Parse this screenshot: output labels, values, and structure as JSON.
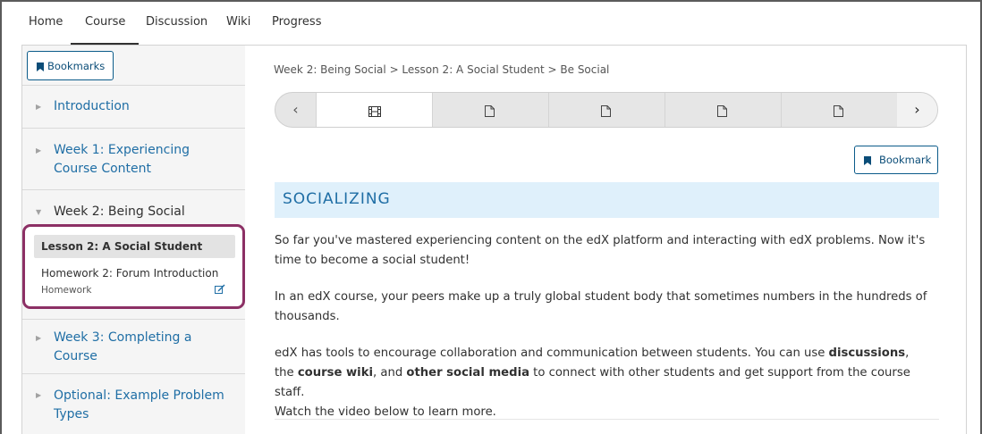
{
  "topnav": {
    "tabs": [
      {
        "label": "Home"
      },
      {
        "label": "Course"
      },
      {
        "label": "Discussion"
      },
      {
        "label": "Wiki"
      },
      {
        "label": "Progress"
      }
    ],
    "active_tab": "Course"
  },
  "sidebar": {
    "bookmarks_label": "Bookmarks",
    "sections": [
      {
        "title": "Introduction"
      },
      {
        "title": "Week 1: Experiencing Course Content"
      },
      {
        "title": "Week 2: Being Social"
      },
      {
        "title": "Week 3: Completing a Course"
      },
      {
        "title": "Optional: Example Problem Types"
      }
    ],
    "open_section": {
      "active_subsection": "Lesson 2: A Social Student",
      "subsection_title": "Homework 2: Forum Introduction",
      "subsection_type": "Homework"
    }
  },
  "main": {
    "breadcrumb": "Week 2: Being Social > Lesson 2: A Social Student > Be Social",
    "sequence": {
      "tabs": [
        {
          "icon": "video-icon",
          "active": true
        },
        {
          "icon": "page-icon",
          "active": false
        },
        {
          "icon": "page-icon",
          "active": false
        },
        {
          "icon": "page-icon",
          "active": false
        },
        {
          "icon": "page-icon",
          "active": false
        }
      ],
      "prev_icon": "chevron-left-icon",
      "next_icon": "chevron-right-icon"
    },
    "bookmark_label": "Bookmark",
    "heading": "SOCIALIZING",
    "paragraph1_line1": "So far you've mastered experiencing content on the edX platform and interacting with edX problems. Now it's",
    "paragraph1_line2": "time to become a social student!",
    "paragraph2_line1": "In an edX course, your peers make up a truly global student body that sometimes numbers in the hundreds of",
    "paragraph2_line2": "thousands.",
    "paragraph3": {
      "p1": "edX has tools to encourage collaboration and communication between students. You can use ",
      "b1": "discussions",
      "p2": ",",
      "p3": "the ",
      "b2": "course wiki",
      "p4": ", and ",
      "b3": "other social media",
      "p5": " to connect with other students and get support from the course staff.",
      "line3": "Watch the video below to learn more."
    }
  },
  "colors": {
    "link": "#1f6ea5",
    "highlight_border": "#8c3065",
    "heading_bg": "#dff0fb",
    "button_border": "#0b5b8a"
  }
}
